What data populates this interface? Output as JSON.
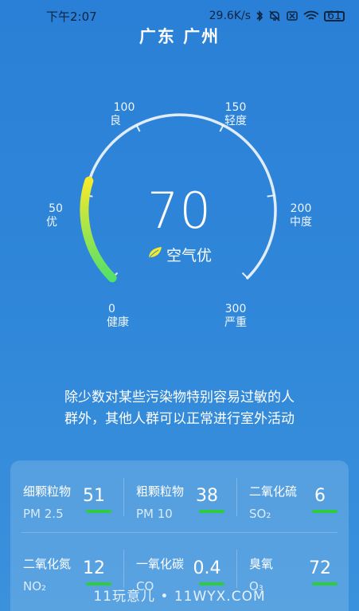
{
  "status": {
    "time": "下午2:07",
    "speed": "29.6K/s",
    "battery": "61"
  },
  "header": {
    "city": "广东 广州"
  },
  "gauge": {
    "value": "70",
    "level": "空气优",
    "ticks": [
      {
        "num": "0",
        "label": "健康"
      },
      {
        "num": "50",
        "label": "优"
      },
      {
        "num": "100",
        "label": "良"
      },
      {
        "num": "150",
        "label": "轻度"
      },
      {
        "num": "200",
        "label": "中度"
      },
      {
        "num": "300",
        "label": "严重"
      }
    ],
    "fill_fraction": 0.233
  },
  "advice": {
    "line1": "除少数对某些污染物特别容易过敏的人",
    "line2": "群外，其他人群可以正常进行室外活动"
  },
  "pollutants": [
    {
      "name": "细颗粒物",
      "sub": "PM 2.5",
      "value": "51"
    },
    {
      "name": "粗颗粒物",
      "sub": "PM 10",
      "value": "38"
    },
    {
      "name": "二氧化硫",
      "sub": "SO₂",
      "value": "6"
    },
    {
      "name": "二氧化氮",
      "sub": "NO₂",
      "value": "12"
    },
    {
      "name": "一氧化碳",
      "sub": "CO",
      "value": "0.4"
    },
    {
      "name": "臭氧",
      "sub": "O₃",
      "value": "72"
    }
  ],
  "watermark": "11玩意儿 • 11WYX.COM",
  "colors": {
    "good": "#2ecc40",
    "arc_start": "#f6ea2a",
    "arc_end": "#54e06a"
  }
}
